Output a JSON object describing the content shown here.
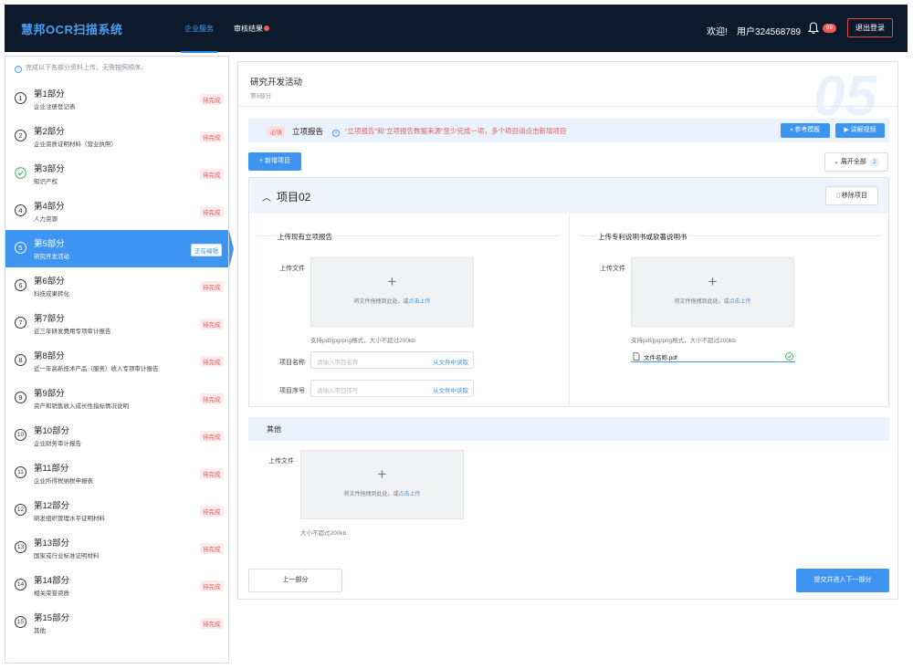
{
  "header": {
    "brand": "慧邦OCR扫描系统",
    "tabs": [
      {
        "label": "企业服务",
        "active": true
      },
      {
        "label": "审核结果",
        "active": false
      }
    ],
    "welcome": "欢迎!",
    "user": "用户324568789",
    "notification_count": "99",
    "logout": "退出登录"
  },
  "sidebar": {
    "hint": "完成以下各部分资料上传，无需按照顺序。",
    "items": [
      {
        "num": "1",
        "title": "第1部分",
        "sub": "企业注册登记表",
        "status": "待完成"
      },
      {
        "num": "2",
        "title": "第2部分",
        "sub": "企业资质证明材料（营业执照）",
        "status": "待完成"
      },
      {
        "num": "✓",
        "title": "第3部分",
        "sub": "知识产权",
        "status": "待完成"
      },
      {
        "num": "4",
        "title": "第4部分",
        "sub": "人力资源",
        "status": "待完成"
      },
      {
        "num": "5",
        "title": "第5部分",
        "sub": "研究开发活动",
        "status": "正在编辑"
      },
      {
        "num": "6",
        "title": "第6部分",
        "sub": "科技成果转化",
        "status": "待完成"
      },
      {
        "num": "7",
        "title": "第7部分",
        "sub": "近三年研发费用专项审计报告",
        "status": "待完成"
      },
      {
        "num": "8",
        "title": "第8部分",
        "sub": "近一年高新技术产品（服务）收入专项审计报告",
        "status": "待完成"
      },
      {
        "num": "9",
        "title": "第9部分",
        "sub": "资产和销售收入成长性指标情况说明",
        "status": "待完成"
      },
      {
        "num": "10",
        "title": "第10部分",
        "sub": "企业财务审计报告",
        "status": "待完成"
      },
      {
        "num": "11",
        "title": "第11部分",
        "sub": "企业所得税纳税申报表",
        "status": "待完成"
      },
      {
        "num": "12",
        "title": "第12部分",
        "sub": "研发组织管理水平证明材料",
        "status": "待完成"
      },
      {
        "num": "13",
        "title": "第13部分",
        "sub": "国家或行业标准证明材料",
        "status": "待完成"
      },
      {
        "num": "14",
        "title": "第14部分",
        "sub": "相关荣誉资质",
        "status": "待完成"
      },
      {
        "num": "15",
        "title": "第15部分",
        "sub": "其他",
        "status": "待完成"
      }
    ]
  },
  "main": {
    "big_number": "05",
    "title": "研究开发活动",
    "subtitle": "第5部分",
    "required_tag": "必填",
    "section_title": "立项报告",
    "section_note": "“立项报告”和“立项报告数据来源”至少完成一项，多个项目请点击新增项目",
    "btn_template": "参考模板",
    "btn_video": "讲解视频",
    "btn_add_project": "+ 新增项目",
    "btn_expand_all": "展开全部",
    "expand_count": "2",
    "project": {
      "title": "项目02",
      "remove": "移除项目",
      "left_section": "上传现有立项报告",
      "right_section": "上传专利说明书或软著说明书",
      "upload_label": "上传文件",
      "drop_plus": "+",
      "drop_text": "将文件拖拽到此处。或",
      "drop_link": "点击上传",
      "format_tip": "支持pdf/jpg/png格式，大小不超过200kb",
      "name_label": "项目名称",
      "name_placeholder": "请输入项目名称",
      "seq_label": "项目序号",
      "seq_placeholder": "请输入项目序号",
      "read_from_file": "从文件中读取",
      "uploaded_file": "文件名称.pdf"
    },
    "other": {
      "title": "其他",
      "upload_label": "上传文件",
      "size_tip": "大小不超过200kb"
    },
    "btn_prev": "上一部分",
    "btn_next": "提交并进入下一部分"
  },
  "colors": {
    "header_bg": "#0d1a2c",
    "accent": "#3d94f1",
    "danger": "#e45b5b",
    "success": "#36b15a"
  }
}
